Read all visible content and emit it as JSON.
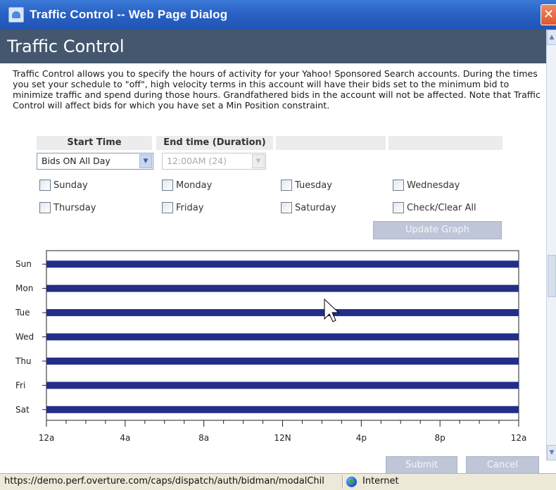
{
  "window": {
    "title": "Traffic Control -- Web Page Dialog",
    "close_label": "✕"
  },
  "header": {
    "title": "Traffic Control"
  },
  "description": "Traffic Control allows you to specify the hours of activity for your Yahoo! Sponsored Search accounts. During the times you set your schedule to \"off\", high velocity terms in this account will have their bids set to the minimum bid to minimize traffic and spend during those hours. Grandfathered bids in the account will not be affected. Note that Traffic Control will affect bids for which you have set a Min Position constraint.",
  "table": {
    "headers": [
      "Start Time",
      "End time (Duration)",
      "",
      ""
    ],
    "start_select": {
      "value": "Bids ON All Day"
    },
    "end_select": {
      "value": "12:00AM (24)",
      "disabled": true
    }
  },
  "days": {
    "sunday": "Sunday",
    "monday": "Monday",
    "tuesday": "Tuesday",
    "wednesday": "Wednesday",
    "thursday": "Thursday",
    "friday": "Friday",
    "saturday": "Saturday",
    "check_all": "Check/Clear All"
  },
  "buttons": {
    "update_graph": "Update Graph",
    "submit": "Submit",
    "cancel": "Cancel"
  },
  "chart_data": {
    "type": "bar",
    "orientation": "horizontal",
    "categories": [
      "Sun",
      "Mon",
      "Tue",
      "Wed",
      "Thu",
      "Fri",
      "Sat"
    ],
    "x_tick_labels": [
      "12a",
      "4a",
      "8a",
      "12N",
      "4p",
      "8p",
      "12a"
    ],
    "x_range_hours": [
      0,
      24
    ],
    "bars": [
      {
        "day": "Sun",
        "start": 0,
        "end": 24
      },
      {
        "day": "Mon",
        "start": 0,
        "end": 24
      },
      {
        "day": "Tue",
        "start": 0,
        "end": 24
      },
      {
        "day": "Wed",
        "start": 0,
        "end": 24
      },
      {
        "day": "Thu",
        "start": 0,
        "end": 24
      },
      {
        "day": "Fri",
        "start": 0,
        "end": 24
      },
      {
        "day": "Sat",
        "start": 0,
        "end": 24
      }
    ],
    "bar_color": "#222e88",
    "grid": false
  },
  "statusbar": {
    "url": "https://demo.perf.overture.com/caps/dispatch/auth/bidman/modalChil",
    "zone": "Internet"
  },
  "colors": {
    "titlebar": "#2a62c4",
    "header": "#44576e",
    "bar": "#222e88"
  }
}
